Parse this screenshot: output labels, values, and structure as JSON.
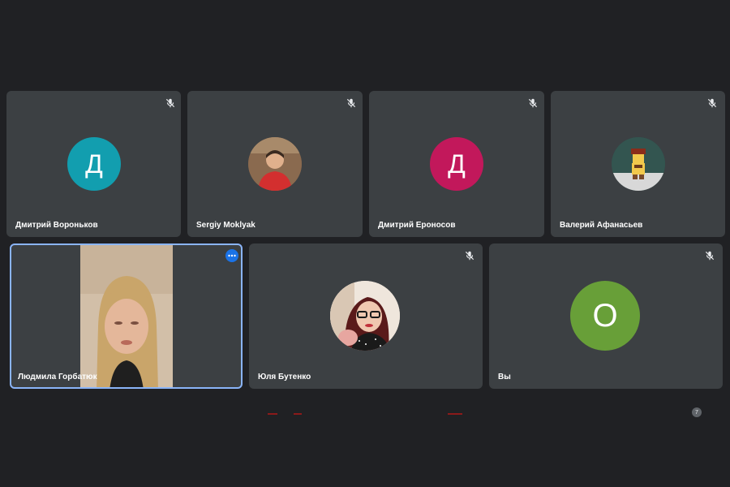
{
  "participants": [
    {
      "name": "Дмитрий Вороньков",
      "initial": "Д",
      "avatar_color": "#129eaf",
      "avatar_type": "initial",
      "muted": true
    },
    {
      "name": "Sergiy Moklyak",
      "initial": "",
      "avatar_type": "photo",
      "muted": true
    },
    {
      "name": "Дмитрий Ероносов",
      "initial": "Д",
      "avatar_color": "#c2185b",
      "avatar_type": "initial",
      "muted": true
    },
    {
      "name": "Валерий Афанасьев",
      "initial": "",
      "avatar_type": "photo",
      "muted": true
    },
    {
      "name": "Людмила Горбатюк",
      "avatar_type": "video",
      "speaking": true
    },
    {
      "name": "Юля Бутенко",
      "initial": "",
      "avatar_type": "photo",
      "muted": true
    },
    {
      "name": "Вы",
      "initial": "О",
      "avatar_color": "#689f38",
      "avatar_type": "initial",
      "muted": true
    }
  ],
  "participant_count": "7",
  "colors": {
    "background": "#202124",
    "tile": "#3c4043",
    "speaking_border": "#8ab4f8",
    "more_button": "#1a73e8"
  },
  "icons": {
    "muted": "mic-off-icon",
    "more": "more-options-icon"
  }
}
